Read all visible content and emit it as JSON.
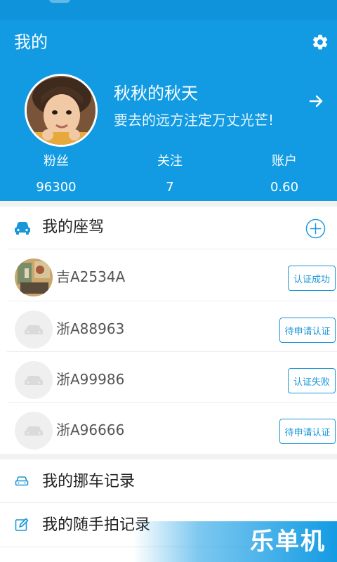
{
  "header": {
    "title": "我的",
    "profile": {
      "name": "秋秋的秋天",
      "motto": "要去的远方注定万丈光芒!"
    },
    "stats": [
      {
        "label": "粉丝",
        "value": "96300"
      },
      {
        "label": "关注",
        "value": "7"
      },
      {
        "label": "账户",
        "value": "0.60"
      }
    ]
  },
  "cars": {
    "title": "我的座驾",
    "items": [
      {
        "plate": "吉A2534A",
        "status": "认证成功"
      },
      {
        "plate": "浙A88963",
        "status": "待申请认证"
      },
      {
        "plate": "浙A99986",
        "status": "认证失败"
      },
      {
        "plate": "浙A96666",
        "status": "待申请认证"
      }
    ]
  },
  "menu": {
    "items": [
      {
        "label": "我的挪车记录",
        "icon": "car-outline-icon"
      },
      {
        "label": "我的随手拍记录",
        "icon": "edit-icon"
      }
    ]
  },
  "watermark": {
    "text": "乐单机"
  },
  "colors": {
    "accent": "#129be3",
    "button_border": "#1a97d7"
  }
}
